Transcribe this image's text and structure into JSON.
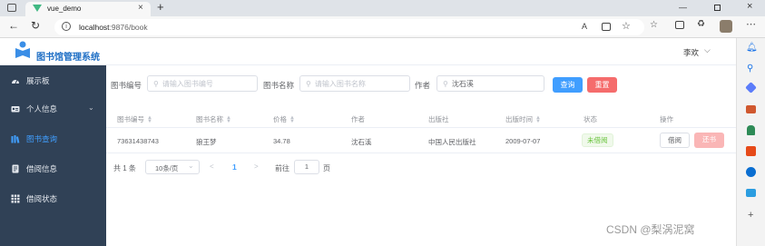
{
  "browser": {
    "tab_title": "vue_demo",
    "url_host": "localhost",
    "url_path": ":9876/book"
  },
  "app": {
    "title": "图书馆管理系统",
    "user": "李欢"
  },
  "sidebar": {
    "items": [
      {
        "label": "展示板",
        "icon": "dashboard-icon"
      },
      {
        "label": "个人信息",
        "icon": "id-card-icon"
      },
      {
        "label": "图书查询",
        "icon": "books-icon"
      },
      {
        "label": "借阅信息",
        "icon": "ledger-icon"
      },
      {
        "label": "借阅状态",
        "icon": "grid-icon"
      }
    ]
  },
  "search": {
    "book_no_label": "图书编号",
    "book_no_placeholder": "请输入图书编号",
    "book_name_label": "图书名称",
    "book_name_placeholder": "请输入图书名称",
    "author_label": "作者",
    "author_value": "沈石溪",
    "query_button": "查询",
    "reset_button": "重置"
  },
  "table": {
    "headers": [
      "图书编号",
      "图书名称",
      "价格",
      "作者",
      "出版社",
      "出版时间",
      "状态",
      "操作"
    ],
    "rows": [
      {
        "book_no": "73631438743",
        "name": "狼王梦",
        "price": "34.78",
        "author": "沈石溪",
        "publisher": "中国人民出版社",
        "date": "2009-07-07",
        "status": "未借阅",
        "borrow": "借阅",
        "return": "还书"
      }
    ]
  },
  "pagination": {
    "total": "共 1 条",
    "page_size": "10条/页",
    "current": "1",
    "goto_label": "前往",
    "goto_value": "1",
    "page_suffix": "页"
  },
  "watermark": "CSDN @梨涡泥窝",
  "colors": {
    "sidebar_bg": "#304156",
    "primary": "#409eff",
    "danger": "#f56c6c",
    "success_tag_bg": "#f0f9eb",
    "success_tag_text": "#67c23a"
  }
}
